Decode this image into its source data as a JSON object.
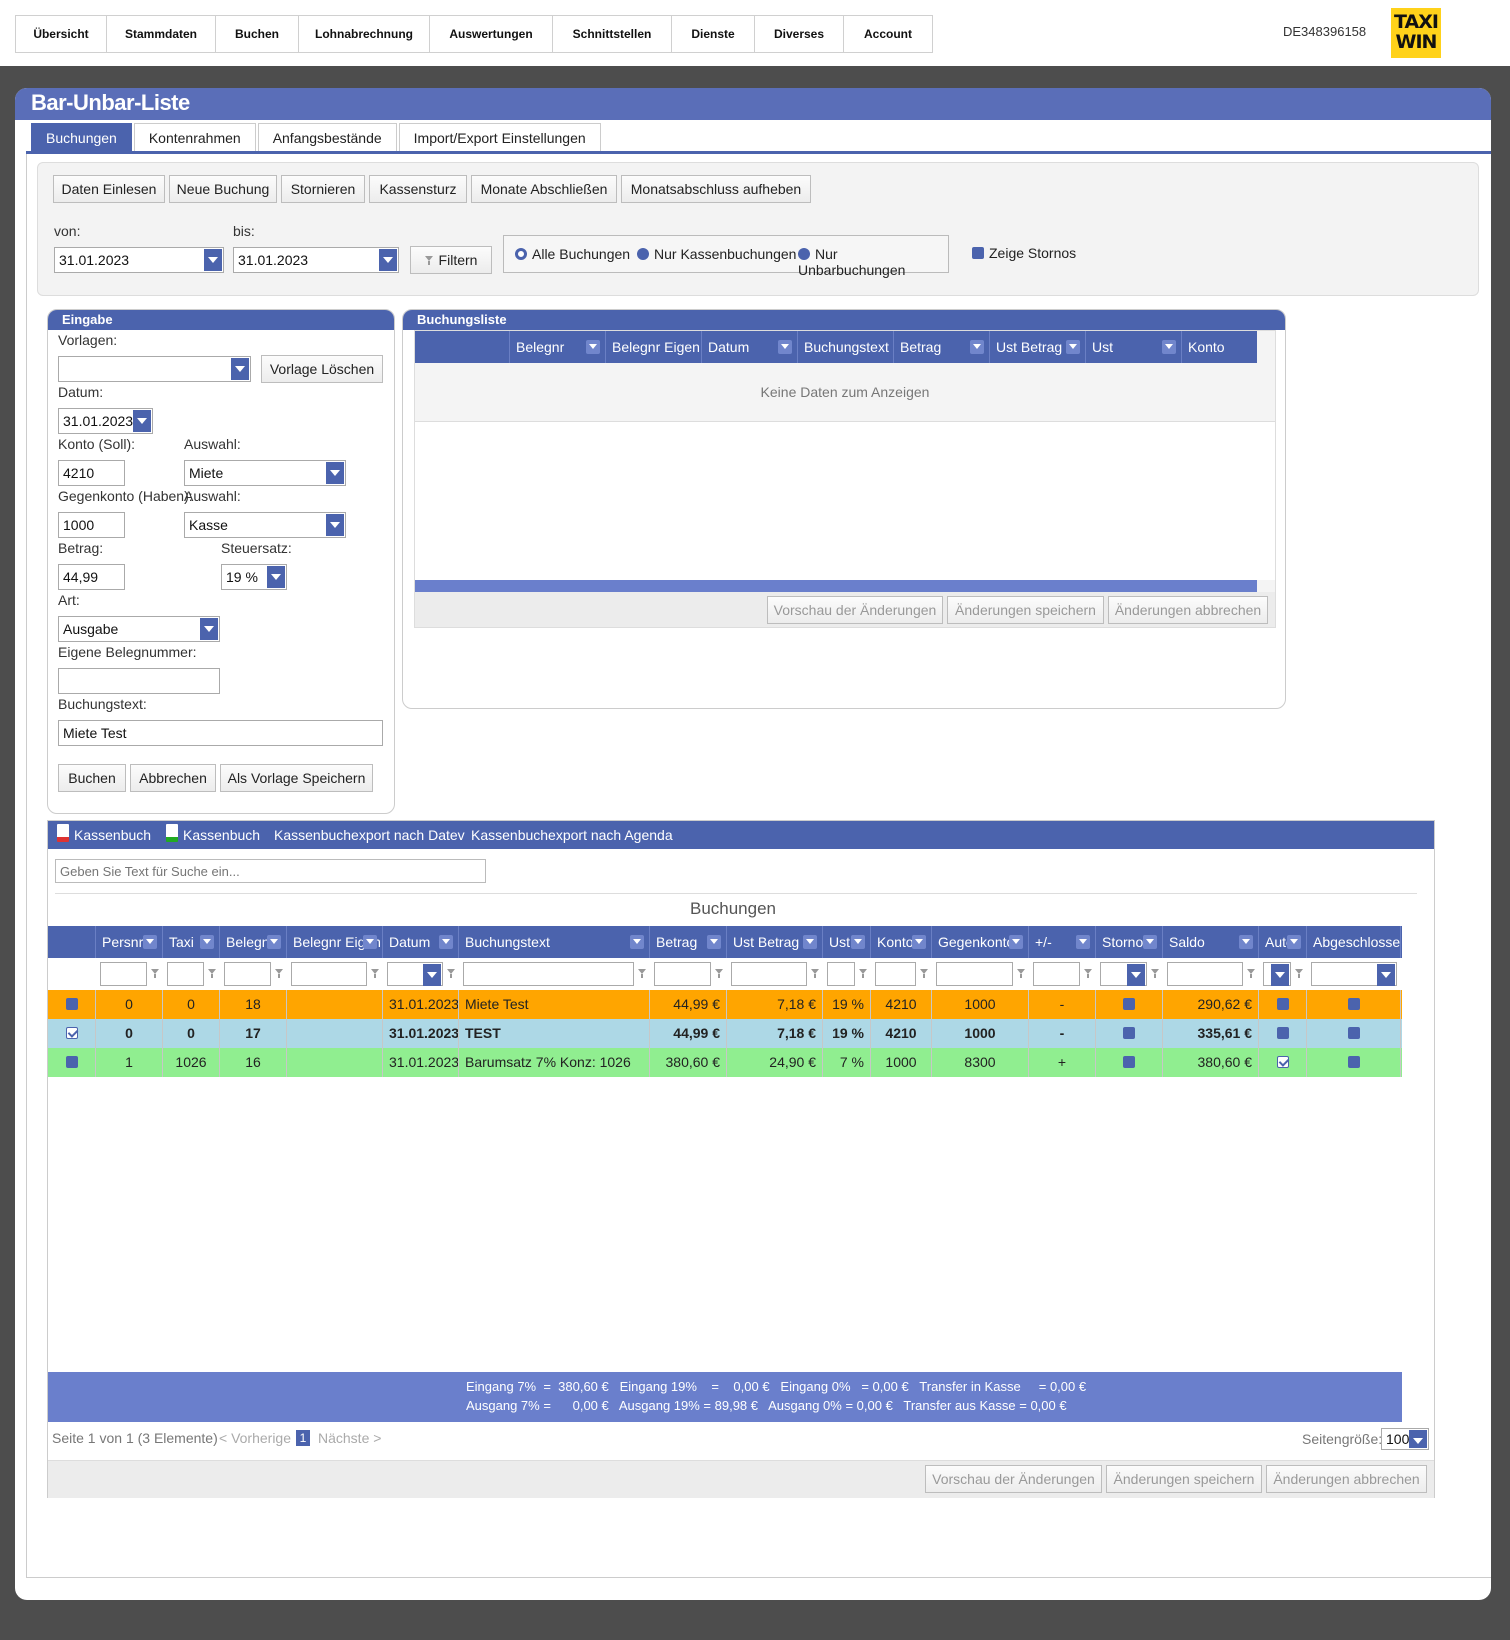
{
  "nav": [
    "Übersicht",
    "Stammdaten",
    "Buchen",
    "Lohnabrechnung",
    "Auswertungen",
    "Schnittstellen",
    "Dienste",
    "Diverses",
    "Account"
  ],
  "account_id": "DE348396158",
  "logo": {
    "line1": "TAXI",
    "line2": "WIN",
    "color": "#ffd21a"
  },
  "page_title": "Bar-Unbar-Liste",
  "tabs": [
    "Buchungen",
    "Kontenrahmen",
    "Anfangsbestände",
    "Import/Export Einstellungen"
  ],
  "toolbar": {
    "buttons": [
      "Daten Einlesen",
      "Neue Buchung",
      "Stornieren",
      "Kassensturz",
      "Monate Abschließen",
      "Monatsabschluss aufheben"
    ],
    "von_label": "von:",
    "von_value": "31.01.2023",
    "bis_label": "bis:",
    "bis_value": "31.01.2023",
    "filter_label": "Filtern",
    "radios": [
      "Alle Buchungen",
      "Nur Kassenbuchungen",
      "Nur Unbarbuchungen"
    ],
    "show_storno_label": "Zeige Stornos"
  },
  "eingabe": {
    "title": "Eingabe",
    "vorlagen_label": "Vorlagen:",
    "vorlagen_value": "",
    "vorlage_loeschen": "Vorlage Löschen",
    "datum_label": "Datum:",
    "datum_value": "31.01.2023",
    "konto_label": "Konto (Soll):",
    "konto_value": "4210",
    "auswahl1_label": "Auswahl:",
    "auswahl1_value": "Miete",
    "gegenkonto_label": "Gegenkonto (Haben):",
    "gegenkonto_value": "1000",
    "auswahl2_label": "Auswahl:",
    "auswahl2_value": "Kasse",
    "betrag_label": "Betrag:",
    "betrag_value": "44,99",
    "steuersatz_label": "Steuersatz:",
    "steuersatz_value": "19 %",
    "art_label": "Art:",
    "art_value": "Ausgabe",
    "eigene_label": "Eigene Belegnummer:",
    "eigene_value": "",
    "buchungstext_label": "Buchungstext:",
    "buchungstext_value": "Miete Test",
    "btn_buchen": "Buchen",
    "btn_abbrechen": "Abbrechen",
    "btn_vorlage": "Als Vorlage Speichern"
  },
  "buchungsliste": {
    "title": "Buchungsliste",
    "columns": [
      "Belegnr",
      "Belegnr Eigen",
      "Datum",
      "Buchungstext",
      "Betrag",
      "Ust Betrag",
      "Ust",
      "Konto"
    ],
    "empty_text": "Keine Daten zum Anzeigen",
    "btn_preview": "Vorschau der Änderungen",
    "btn_save": "Änderungen speichern",
    "btn_cancel": "Änderungen abbrechen"
  },
  "exports": [
    "Kassenbuch",
    "Kassenbuch",
    "Kassenbuchexport nach Datev",
    "Kassenbuchexport nach Agenda"
  ],
  "search_placeholder": "Geben Sie Text für Suche ein...",
  "grid_title": "Buchungen",
  "grid_columns": [
    "",
    "Persnr",
    "Taxi",
    "Belegnr",
    "Belegnr Eigen",
    "Datum",
    "Buchungstext",
    "Betrag",
    "Ust Betrag",
    "Ust",
    "Konto",
    "Gegenkonto",
    "+/-",
    "Storno",
    "Saldo",
    "Auto",
    "Abgeschlossen"
  ],
  "rows": [
    {
      "selected": false,
      "persnr": "0",
      "taxi": "0",
      "belegnr": "18",
      "eigen": "",
      "datum": "31.01.2023",
      "text": "Miete Test",
      "betrag": "44,99 €",
      "ust_betrag": "7,18 €",
      "ust": "19 %",
      "konto": "4210",
      "gegenkonto": "1000",
      "pm": "-",
      "storno": false,
      "saldo": "290,62 €",
      "auto": false,
      "abgeschlossen": false,
      "bg": "#ffa500",
      "bold": false
    },
    {
      "selected": true,
      "persnr": "0",
      "taxi": "0",
      "belegnr": "17",
      "eigen": "",
      "datum": "31.01.2023",
      "text": "TEST",
      "betrag": "44,99 €",
      "ust_betrag": "7,18 €",
      "ust": "19 %",
      "konto": "4210",
      "gegenkonto": "1000",
      "pm": "-",
      "storno": false,
      "saldo": "335,61 €",
      "auto": false,
      "abgeschlossen": false,
      "bg": "#add8e6",
      "bold": true
    },
    {
      "selected": false,
      "persnr": "1",
      "taxi": "1026",
      "belegnr": "16",
      "eigen": "",
      "datum": "31.01.2023",
      "text": "Barumsatz 7% Konz: 1026",
      "betrag": "380,60 €",
      "ust_betrag": "24,90 €",
      "ust": "7 %",
      "konto": "1000",
      "gegenkonto": "8300",
      "pm": "+",
      "storno": false,
      "saldo": "380,60 €",
      "auto": true,
      "abgeschlossen": false,
      "bg": "#90ee90",
      "bold": false
    }
  ],
  "summary": {
    "line1": "Eingang 7%  =  380,60 €   Eingang 19%    =    0,00 €   Eingang 0%   = 0,00 €   Transfer in Kasse     = 0,00 €",
    "line2": "Ausgang 7% =      0,00 €   Ausgang 19% = 89,98 €   Ausgang 0% = 0,00 €   Transfer aus Kasse = 0,00 €"
  },
  "pager": {
    "info": "Seite 1 von 1 (3 Elemente)",
    "prev": "< Vorherige",
    "page": "1",
    "next": "Nächste >",
    "size_label": "Seitengröße:",
    "size_value": "100"
  },
  "bottom_buttons": [
    "Vorschau der Änderungen",
    "Änderungen speichern",
    "Änderungen abbrechen"
  ]
}
